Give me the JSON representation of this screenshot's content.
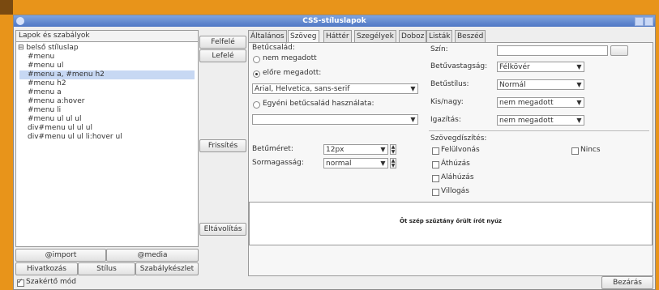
{
  "window": {
    "title": "CSS-stíluslapok"
  },
  "left": {
    "header": "Lapok és szabályok",
    "tree": [
      "⊟ belső stíluslap",
      "#menu",
      "#menu ul",
      "#menu a, #menu h2",
      "#menu h2",
      "#menu a",
      "#menu a:hover",
      "#menu li",
      "#menu ul ul ul",
      "div#menu ul ul ul",
      "div#menu ul ul li:hover ul"
    ],
    "selected_index": 3,
    "buttons": {
      "import": "@import",
      "media": "@media",
      "link": "Hivatkozás",
      "style": "Stílus",
      "ruleset": "Szabálykészlet"
    },
    "expert_mode": "Szakértő mód"
  },
  "middle": {
    "up": "Felfelé",
    "down": "Lefelé",
    "refresh": "Frissítés",
    "remove": "Eltávolítás"
  },
  "tabs": [
    "Általános",
    "Szöveg",
    "Háttér",
    "Szegélyek",
    "Doboz",
    "Listák",
    "Beszéd"
  ],
  "active_tab": 1,
  "text": {
    "font_family_label": "Betűcsalád:",
    "opt_unspecified": "nem megadott",
    "opt_predefined": "előre megadott:",
    "predefined_value": "Arial, Helvetica, sans-serif",
    "opt_custom": "Egyéni betűcsalád használata:",
    "font_size_label": "Betűméret:",
    "font_size_value": "12px",
    "line_height_label": "Sormagasság:",
    "line_height_value": "normal",
    "color_label": "Szín:",
    "weight_label": "Betűvastagság:",
    "weight_value": "Félkövér",
    "style_label": "Betűstílus:",
    "style_value": "Normál",
    "case_label": "Kis/nagy:",
    "case_value": "nem megadott",
    "align_label": "Igazítás:",
    "align_value": "nem megadott",
    "decoration_label": "Szövegdíszítés:",
    "deco_overline": "Felülvonás",
    "deco_none": "Nincs",
    "deco_strike": "Áthúzás",
    "deco_underline": "Aláhúzás",
    "deco_blink": "Villogás",
    "preview": "Öt szép szűztány őrült írót nyúz"
  },
  "close": "Bezárás"
}
